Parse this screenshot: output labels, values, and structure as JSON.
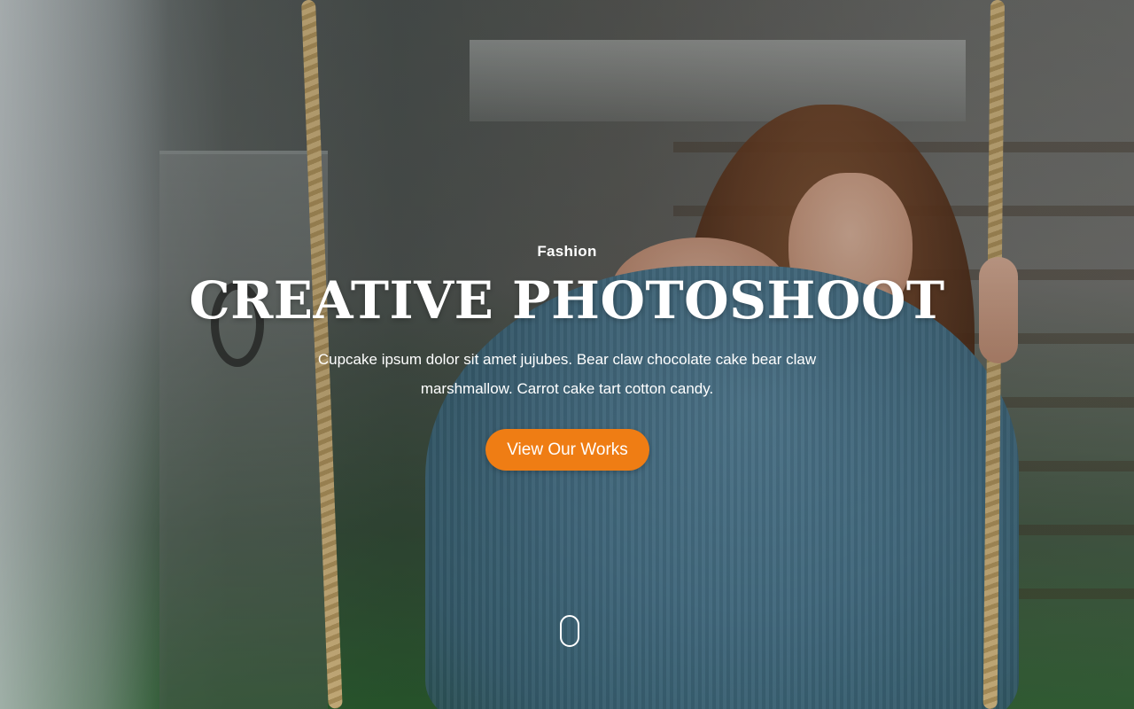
{
  "hero": {
    "eyebrow": "Fashion",
    "title": "CREATIVE PHOTOSHOOT",
    "description": "Cupcake ipsum dolor sit amet jujubes. Bear claw chocolate cake bear claw marshmallow. Carrot cake tart cotton candy.",
    "cta_label": "View Our Works"
  },
  "colors": {
    "accent": "#ef7d14",
    "text": "#ffffff"
  },
  "icons": {
    "scroll": "mouse-scroll-icon"
  }
}
